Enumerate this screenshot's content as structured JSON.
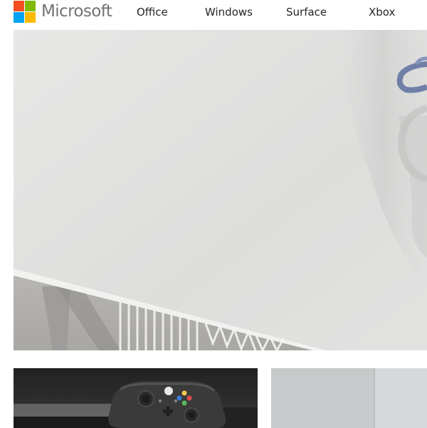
{
  "brand": {
    "name": "Microsoft",
    "colors": {
      "red": "#f25022",
      "green": "#7fba00",
      "blue": "#00a4ef",
      "yellow": "#ffb900",
      "wordmark": "#737373"
    }
  },
  "nav": {
    "items": [
      {
        "label": "Office"
      },
      {
        "label": "Windows"
      },
      {
        "label": "Surface"
      },
      {
        "label": "Xbox"
      }
    ]
  },
  "hero": {
    "image": "white-desk-with-blue-mug-and-shadow"
  },
  "cards": [
    {
      "image": "xbox-one-controller-on-console"
    },
    {
      "image": "surface-device-grey"
    }
  ]
}
